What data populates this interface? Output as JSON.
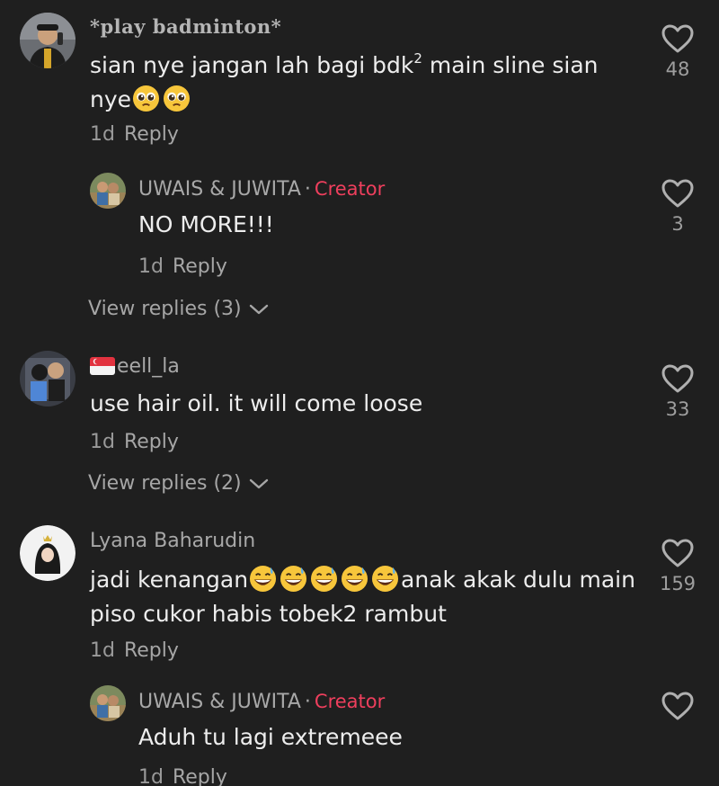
{
  "comments": [
    {
      "username": "*play badminton*",
      "text_a": "sian nye jangan lah bagi bdk",
      "text_sup": "2",
      "text_b": " main sline sian nye",
      "emojis": [
        "pleading-face",
        "pleading-face"
      ],
      "time": "1d",
      "reply_label": "Reply",
      "likes": "48",
      "view_replies": "View replies (3)",
      "reply": {
        "username": "UWAIS & JUWITA",
        "separator": "·",
        "badge": "Creator",
        "text": "NO MORE!!!",
        "time": "1d",
        "reply_label": "Reply",
        "likes": "3"
      }
    },
    {
      "username": "eell_la",
      "flag": "singapore-flag",
      "text": "use hair oil. it will come loose",
      "time": "1d",
      "reply_label": "Reply",
      "likes": "33",
      "view_replies": "View replies (2)"
    },
    {
      "username": "Lyana Baharudin",
      "text_a": "jadi kenangan",
      "emojis": [
        "grinning-sweat-face",
        "grinning-sweat-face",
        "grinning-sweat-face",
        "grinning-sweat-face",
        "grinning-sweat-face"
      ],
      "text_b": "anak akak dulu main piso cukor habis tobek2 rambut",
      "time": "1d",
      "reply_label": "Reply",
      "likes": "159",
      "reply": {
        "username": "UWAIS & JUWITA",
        "separator": "·",
        "badge": "Creator",
        "text": "Aduh tu lagi extremeee",
        "time": "1d",
        "reply_label": "Reply",
        "likes": ""
      }
    }
  ],
  "colors": {
    "background": "#1f1f1f",
    "creator_badge": "#ee3f5d",
    "muted_text": "#a6a6a6"
  }
}
